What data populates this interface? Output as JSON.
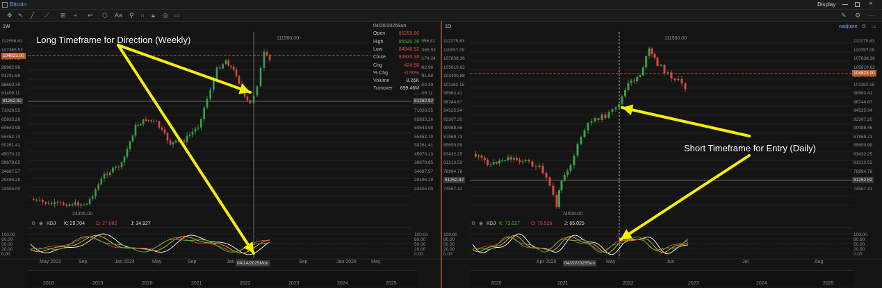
{
  "window": {
    "title": "Bitcoin",
    "display_label": "Display"
  },
  "left": {
    "timeframe": "1W",
    "price_labels": [
      "112556.81",
      "107365.53",
      "102174.24",
      "96982.96",
      "91791.68",
      "86600.39",
      "81409.11",
      "76217.83",
      "71026.55",
      "65835.26",
      "60643.98",
      "55452.70",
      "50261.41",
      "45070.13",
      "39878.85",
      "34687.57",
      "29496.28",
      "24305.00"
    ],
    "highlight_price": "104823.00",
    "crosshair_price": "81262.82",
    "high_label": "111980.00",
    "low_label": "24305.00",
    "ohlc": [
      {
        "key": "04/20/2025Sun",
        "val": "",
        "color": "#cfcfcf"
      },
      {
        "key": "Open",
        "val": "85259.86",
        "color": "#e64545"
      },
      {
        "key": "High",
        "val": "85520.76",
        "color": "#3fbf3f"
      },
      {
        "key": "Low",
        "val": "84848.52",
        "color": "#e64545"
      },
      {
        "key": "Close",
        "val": "84835.38",
        "color": "#e64545"
      },
      {
        "key": "Chg",
        "val": "-424.58",
        "color": "#e64545"
      },
      {
        "key": "% Chg",
        "val": "-0.50%",
        "color": "#e64545"
      },
      {
        "key": "Volume",
        "val": "8.26K",
        "color": "#cfcfcf"
      },
      {
        "key": "Turnover",
        "val": "699.46M",
        "color": "#cfcfcf"
      }
    ],
    "kdj": {
      "name": "KDJ",
      "k": "K: 29.704",
      "d": "D: 27.082",
      "j": "J: 34.927"
    },
    "kdj_scale": [
      "100.00",
      "80.00",
      "50.00",
      "20.00",
      "0.00"
    ],
    "time_labels": [
      "May 2023",
      "Sep",
      "Jan 2024",
      "May",
      "Sep",
      "Jan 2025",
      "Sep",
      "Jan 2026",
      "May"
    ],
    "crosshair_date": "04/14/2025Mon",
    "year_labels": [
      "2018",
      "2019",
      "2020",
      "2021",
      "2022",
      "2023",
      "2024",
      "2025"
    ],
    "annotation": "Long Timeframe for Direction (Weekly)"
  },
  "right": {
    "timeframe": "1D",
    "adjust": "nadjuste",
    "price_labels": [
      "112275.83",
      "110057.09",
      "107838.36",
      "105619.62",
      "103400.88",
      "101182.15",
      "98963.41",
      "96744.67",
      "94525.94",
      "92307.20",
      "90088.46",
      "87869.73",
      "85650.99",
      "83432.25",
      "81213.52",
      "78994.78",
      "76776.04",
      "74557.31"
    ],
    "highlight_price": "104823.00",
    "crosshair_price": "81262.82",
    "high_label": "111980.00",
    "low_label": "74508.00",
    "kdj": {
      "name": "KDJ",
      "k": "K: 72.027",
      "d": "D: 75.526",
      "j": "J: 65.025"
    },
    "kdj_scale": [
      "100.00",
      "80.00",
      "50.00",
      "20.00",
      "0.00"
    ],
    "time_labels": [
      "Apr 2025",
      "May",
      "Jun",
      "Jul",
      "Aug"
    ],
    "crosshair_date": "04/20/2025Sun",
    "year_labels": [
      "2020",
      "2021",
      "2022",
      "2023",
      "2024",
      "2025"
    ],
    "annotation": "Short Timeframe for Entry (Daily)"
  },
  "colors": {
    "up": "#3aa04a",
    "down": "#e04848",
    "arrow": "#f3f000",
    "dashed": "#b85c2a"
  }
}
